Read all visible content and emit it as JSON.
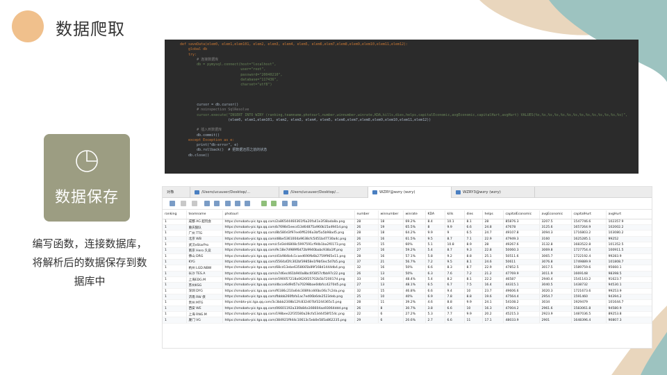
{
  "slide": {
    "title": "数据爬取",
    "card_label": "数据保存",
    "desc_lines": [
      "编写函数，连接数据库，",
      "将解析后的数据保存到数",
      "据库中"
    ]
  },
  "code": {
    "line_numbers": [
      "",
      "",
      "",
      "",
      "",
      "",
      "",
      "",
      "",
      "",
      "",
      "",
      "",
      "",
      "",
      "",
      "",
      "",
      "",
      "",
      "",
      "",
      "",
      "",
      ""
    ],
    "lines": [
      "def saveData(elem0, elem1,elem101, elem2, elem3, elem4, elem5, elem6,elem7,elem8,elem9,elem10,elem11,elem12):",
      "    global db",
      "    try:",
      "        # 连接数据库",
      "        db = pymysql.connect(host=\"localhost\",",
      "                             user=\"root\",",
      "                             password=\"20040210\",",
      "                             database=\"117436\",",
      "                             charset=\"utf8\")",
      "",
      "",
      "",
      "        cursor = db.cursor()",
      "        # noinspection SqlResolve",
      "        cursor.execute(\"INSERT INTO WZRY (ranking,teamname,photourl,number,winnumber,winrate,KDA,kills,dies,helps,capitalEconomic,avgEconomic,capitalHurt,avgHurt) VALUES(%s,%s,%s,%s,%s,%s,%s,%s,%s,%s,%s,%s,%s,%s)\",",
      "                       (elem0, elem1,elem101, elem2, elem3, elem4, elem5, elem6,elem7,elem8,elem9,elem10,elem11,elem12))",
      "",
      "        # 插入到数据库",
      "        db.commit()",
      "    except Exception as e:",
      "        print(\"db-error\", e)",
      "        db.rollback()  # 把数据还原之前的状态",
      "    db.close()",
      ""
    ]
  },
  "db_window": {
    "tabs": [
      "对象",
      "/Users/ucuuser/Desktop/...",
      "/Users/ucuuser/Desktop/...",
      "WZRY@wzry (wzry)",
      "WZRY3@wzry (wzry)"
    ],
    "active_tab": 3,
    "columns": [
      "ranking",
      "teamname",
      "photourl",
      "number",
      "winnumber",
      "winrate",
      "KDA",
      "kills",
      "dies",
      "helps",
      "capitalEconomic",
      "avgEconomic",
      "capitalHurt",
      "avgHurt"
    ],
    "rows": [
      [
        "1",
        "成都 AG 超玩会",
        "https://smobatv-pic.tga.qq.com/2a86544460361f6a20fa41e3f38ada8a.png",
        "28",
        "18",
        "69.2%",
        "8.4",
        "10.1",
        "8.1",
        "28",
        "85876.3",
        "3207.5",
        "1547746.6",
        "102357.9"
      ],
      [
        "1",
        "重庆狼队",
        "https://smobatv-pic.tga.qq.com/b7698d1eecd13d64875a960b15a4941d.png",
        "26",
        "19",
        "65.5%",
        "8",
        "9.9",
        "6.6",
        "24.8",
        "47678",
        "3125.6",
        "1657264.9",
        "102002.2"
      ],
      [
        "1",
        "广州 TTG",
        "https://smobatv-pic.tga.qq.com/8b580d3f97ee6ff6206a3bf5a5b98ad5.png",
        "28",
        "18",
        "64.2%",
        "9.9",
        "9",
        "6.5",
        "24.7",
        "49107.8",
        "3094.3",
        "1716803.2",
        "103080.2"
      ],
      [
        "1",
        "北京 WB",
        "https://smobatv-pic.tga.qq.com/d8be5361004a9638cfc5451bd7730a4c.png",
        "26",
        "16",
        "61.5%",
        "9.5",
        "8.7",
        "7.1",
        "22.9",
        "47949.3",
        "3160",
        "1625285.1",
        "99252"
      ],
      [
        "1",
        "武汉eStarPro",
        "https://smobatv-pic.tga.qq.com/c5d3d46808c5997591cf94b1ba2f0173.png",
        "25",
        "15",
        "60%",
        "5.1",
        "10.8",
        "8.9",
        "28",
        "49267.6",
        "3132.8",
        "1683522.8",
        "101352.5"
      ],
      [
        "1",
        "南京 Hero 久竞",
        "https://smobatv-pic.tga.qq.com/9c18e7d989f6d72b9940babc938a1ff.png",
        "27",
        "16",
        "59.2%",
        "5.4",
        "8.7",
        "9.3",
        "22.8",
        "50060.3",
        "3069.8",
        "1727754.4",
        "100911.5"
      ],
      [
        "1",
        "佛山 DRG",
        "https://smobatv-pic.tga.qq.com/d1b984b4c1caed690fb6b2759f965e11.png",
        "28",
        "16",
        "57.1%",
        "5.8",
        "9.2",
        "8.8",
        "25.1",
        "50511.6",
        "3065.7",
        "1722192.4",
        "99283.9"
      ],
      [
        "1",
        "KYG",
        "https://smobatv-pic.tga.qq.com/5564af2fc302bf39858e1f9bf3ec5d7b5.png",
        "37",
        "21",
        "56.7%",
        "7.2",
        "9.5",
        "8.1",
        "24.6",
        "50611",
        "3076.8",
        "1749889.9",
        "101808.7"
      ],
      [
        "1",
        "杭州 LGD.NBW",
        "https://smobatv-pic.tga.qq.com/68cd13ebe6358665b89f168d1444db4.png",
        "32",
        "16",
        "50%",
        "6.6",
        "8.3",
        "8.7",
        "22.9",
        "47852.5",
        "3017.5",
        "1589759.6",
        "95660.1"
      ],
      [
        "1",
        "长沙 TES.A",
        "https://smobatv-pic.tga.qq.com/a7d6ec461b940a8bc6f3857cfbb97c22.png",
        "26",
        "13",
        "50%",
        "6.3",
        "7.6",
        "7.2",
        "21.2",
        "47769.9",
        "3011.9",
        "1669148",
        "98398.5"
      ],
      [
        "1",
        "上海EDG.M",
        "https://smobatv-pic.tga.qq.com/e590057218a0626f25702b5b720017d.png",
        "33",
        "16",
        "48.4%",
        "5.4",
        "8.2",
        "8.1",
        "22.2",
        "46587",
        "2940.4",
        "1541143.2",
        "91623.7"
      ],
      [
        "1",
        "苏州KSG",
        "https://smobatv-pic.tga.qq.com/dbcce6d9d57a70298bae0dbfcc4270d5.png",
        "27",
        "13",
        "48.1%",
        "6.5",
        "6.7",
        "7.5",
        "16.4",
        "44315.1",
        "3040.5",
        "1438732",
        "94530.1"
      ],
      [
        "1",
        "深圳 DYG",
        "https://smobatv-pic.tga.qq.com/f6186c210a6dc308fdcd46bc06c7c2da.png",
        "32",
        "15",
        "46.8%",
        "6.6",
        "9.4",
        "10",
        "23.7",
        "49606.6",
        "3020.3",
        "1721673.6",
        "99253.9"
      ],
      [
        "1",
        "济南 RW 侠",
        "https://smobatv-pic.tga.qq.com/fbbbb260fbfa1ac7ed06b6de2523deb.png",
        "25",
        "10",
        "40%",
        "6.9",
        "7.8",
        "8.8",
        "19.6",
        "47564.4",
        "2954.7",
        "1591460",
        "94394.2"
      ],
      [
        "1",
        "贵州 MTG",
        "https://smbtv-pic.tga.qq.com/3c3bbb2308b12fc832d07bf3244365c5.png",
        "28",
        "11",
        "39.2%",
        "4.6",
        "8.8",
        "9.9",
        "24.1",
        "54108.2",
        "3034",
        "1929479",
        "101644.7"
      ],
      [
        "1",
        "西安 WE",
        "https://smobatv-pic.tga.qq.com/06601192a330b84a166604aa93064ddd.png",
        "26",
        "8",
        "30.7%",
        "3.8",
        "6.6",
        "10",
        "16.3",
        "47004.2",
        "2961.6",
        "1583061.8",
        "94580.9"
      ],
      [
        "1",
        "上海 RNG.M",
        "https://smobatv-pic.tga.qq.com/198bee22f35580a28cfa53d4458f154c.png",
        "22",
        "6",
        "27.2%",
        "5.3",
        "7.7",
        "9.9",
        "20.2",
        "45215.3",
        "2923.9",
        "1487036.5",
        "89253.8"
      ],
      [
        "1",
        "厦门 VG",
        "https://smobatv-pic.tga.qq.com/384921f944c10613c5eb0e585a862235.png",
        "29",
        "6",
        "20.6%",
        "2.7",
        "6.6",
        "11",
        "17.1",
        "48033.9",
        "2901",
        "1648396.4",
        "90807.3"
      ]
    ]
  },
  "colors": {
    "title_circle": "#f0c08c",
    "card_bg": "#9c9d82",
    "blob_teal": "#9dc3c0",
    "blob_tan": "#e9d6bd",
    "code_bg": "#2b2b2b"
  }
}
